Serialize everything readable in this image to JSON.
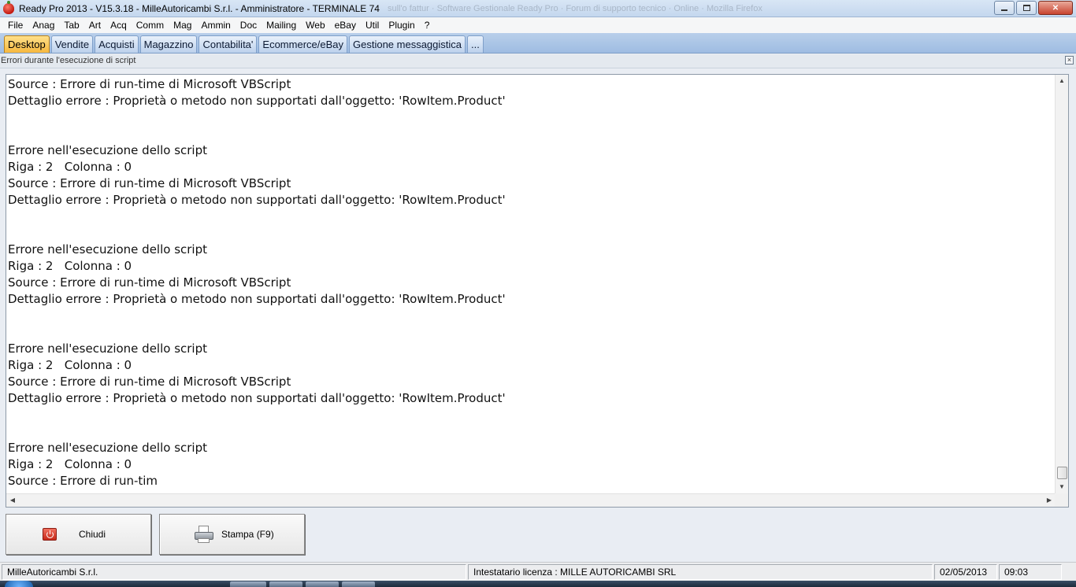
{
  "window": {
    "title": "Ready Pro 2013 - V15.3.18 - MilleAutoricambi S.r.l. - Amministratore - TERMINALE 74",
    "background_title": "sull'o fattur · Software Gestionale Ready Pro · Forum di supporto tecnico · Online · Mozilla Firefox"
  },
  "menu": [
    {
      "label": "File"
    },
    {
      "label": "Anag"
    },
    {
      "label": "Tab"
    },
    {
      "label": "Art"
    },
    {
      "label": "Acq"
    },
    {
      "label": "Comm"
    },
    {
      "label": "Mag"
    },
    {
      "label": "Ammin"
    },
    {
      "label": "Doc"
    },
    {
      "label": "Mailing"
    },
    {
      "label": "Web"
    },
    {
      "label": "eBay"
    },
    {
      "label": "Util"
    },
    {
      "label": "Plugin"
    },
    {
      "label": "?"
    }
  ],
  "tabs": [
    {
      "label": "Desktop",
      "active": true
    },
    {
      "label": "Vendite"
    },
    {
      "label": "Acquisti"
    },
    {
      "label": "Magazzino"
    },
    {
      "label": "Contabilita'"
    },
    {
      "label": "Ecommerce/eBay"
    },
    {
      "label": "Gestione messaggistica"
    },
    {
      "label": "..."
    }
  ],
  "panel": {
    "title": "Errori durante l'esecuzione di script",
    "close_glyph": "×"
  },
  "log_lines": [
    "Source : Errore di run-time di Microsoft VBScript",
    "Dettaglio errore : Proprietà o metodo non supportati dall'oggetto: 'RowItem.Product'",
    "",
    "",
    "Errore nell'esecuzione dello script",
    "Riga : 2   Colonna : 0",
    "Source : Errore di run-time di Microsoft VBScript",
    "Dettaglio errore : Proprietà o metodo non supportati dall'oggetto: 'RowItem.Product'",
    "",
    "",
    "Errore nell'esecuzione dello script",
    "Riga : 2   Colonna : 0",
    "Source : Errore di run-time di Microsoft VBScript",
    "Dettaglio errore : Proprietà o metodo non supportati dall'oggetto: 'RowItem.Product'",
    "",
    "",
    "Errore nell'esecuzione dello script",
    "Riga : 2   Colonna : 0",
    "Source : Errore di run-time di Microsoft VBScript",
    "Dettaglio errore : Proprietà o metodo non supportati dall'oggetto: 'RowItem.Product'",
    "",
    "",
    "Errore nell'esecuzione dello script",
    "Riga : 2   Colonna : 0",
    "Source : Errore di run-tim"
  ],
  "buttons": {
    "close_label": "Chiudi",
    "print_label": "Stampa (F9)"
  },
  "status": {
    "company": "MilleAutoricambi S.r.l.",
    "license": "Intestatario licenza : MILLE AUTORICAMBI SRL",
    "date": "02/05/2013",
    "time": "09:03"
  },
  "colors": {
    "active_tab": "#f6b73e",
    "tabbar": "#9ebce2"
  }
}
